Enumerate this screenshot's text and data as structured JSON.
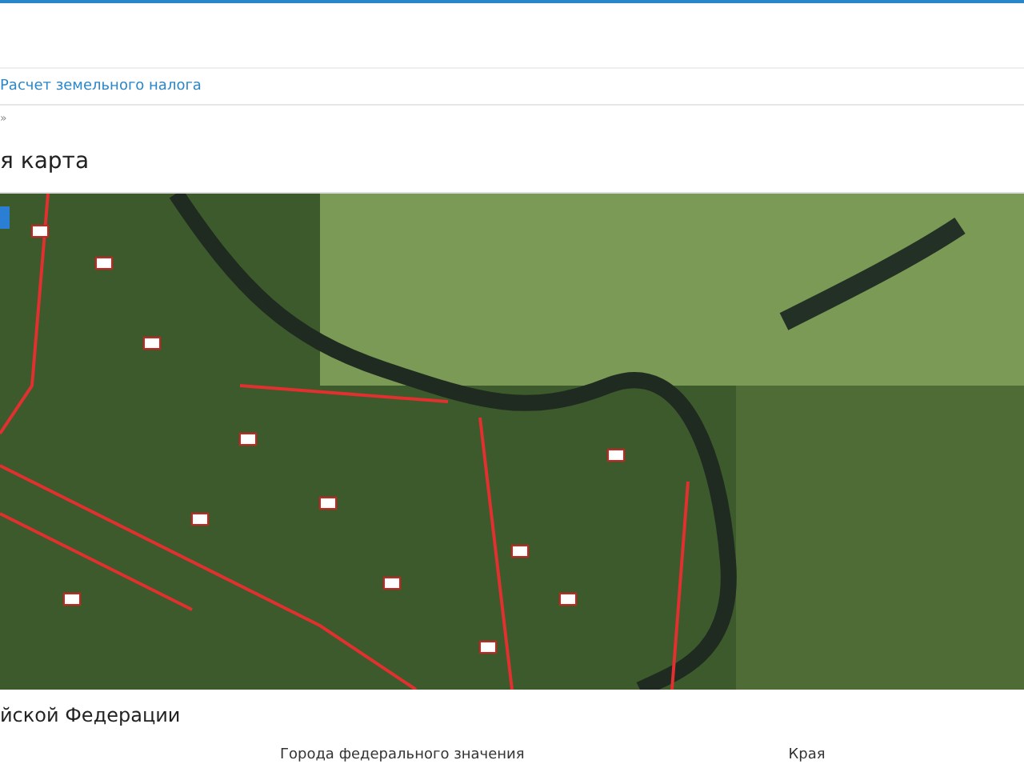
{
  "nav": {
    "link": "Расчет земельного налога"
  },
  "breadcrumb": {
    "separator": "»"
  },
  "page": {
    "title": "я карта"
  },
  "map": {
    "zoom_control": true
  },
  "section": {
    "title": "йской Федерации",
    "table": {
      "columns": [
        "Города федерального значения",
        "Края"
      ]
    }
  }
}
